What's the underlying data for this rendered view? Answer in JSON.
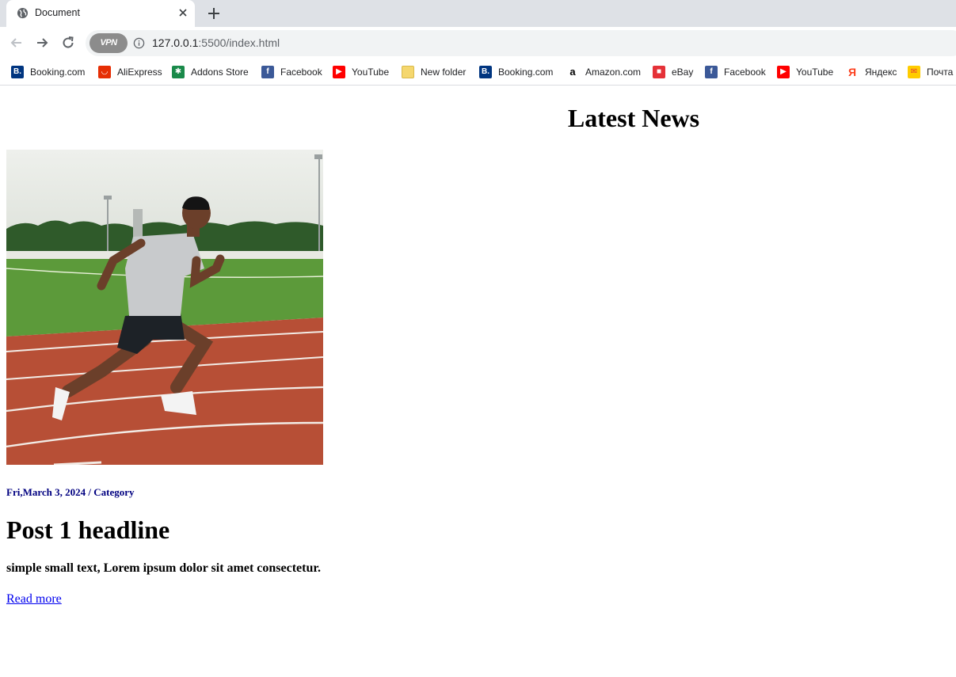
{
  "browser": {
    "tab": {
      "title": "Document"
    },
    "url": {
      "host": "127.0.0.1",
      "path": ":5500/index.html"
    },
    "vpn_label": "VPN",
    "bookmarks": [
      {
        "label": "Booking.com",
        "icon": "booking-icon",
        "color": "#003580",
        "glyph": "B."
      },
      {
        "label": "AliExpress",
        "icon": "aliexpress-icon",
        "color": "#e62e04",
        "glyph": "◡"
      },
      {
        "label": "Addons Store",
        "icon": "addons-store-icon",
        "color": "#1a8a4a",
        "glyph": "✱"
      },
      {
        "label": "Facebook",
        "icon": "facebook-icon",
        "color": "#3b5998",
        "glyph": "f"
      },
      {
        "label": "YouTube",
        "icon": "youtube-icon",
        "color": "#ff0000",
        "glyph": "▶"
      },
      {
        "label": "New folder",
        "icon": "folder-icon",
        "color": "#f5d76e",
        "glyph": ""
      },
      {
        "label": "Booking.com",
        "icon": "booking-icon",
        "color": "#003580",
        "glyph": "B."
      },
      {
        "label": "Amazon.com",
        "icon": "amazon-icon",
        "color": "#ffffff",
        "glyph": "a"
      },
      {
        "label": "eBay",
        "icon": "ebay-icon",
        "color": "#e53238",
        "glyph": "■"
      },
      {
        "label": "Facebook",
        "icon": "facebook-icon",
        "color": "#3b5998",
        "glyph": "f"
      },
      {
        "label": "YouTube",
        "icon": "youtube-icon",
        "color": "#ff0000",
        "glyph": "▶"
      },
      {
        "label": "Яндекс",
        "icon": "yandex-icon",
        "color": "#ffffff",
        "glyph": "Я"
      },
      {
        "label": "Почта",
        "icon": "mail-icon",
        "color": "#ffcc00",
        "glyph": "✉"
      }
    ]
  },
  "page": {
    "title": "Latest News",
    "posts": [
      {
        "meta": "Fri,March 3, 2024 / Category",
        "headline": "Post 1 headline",
        "summary": "simple small text, Lorem ipsum dolor sit amet consectetur.",
        "link": "Read more"
      }
    ]
  }
}
